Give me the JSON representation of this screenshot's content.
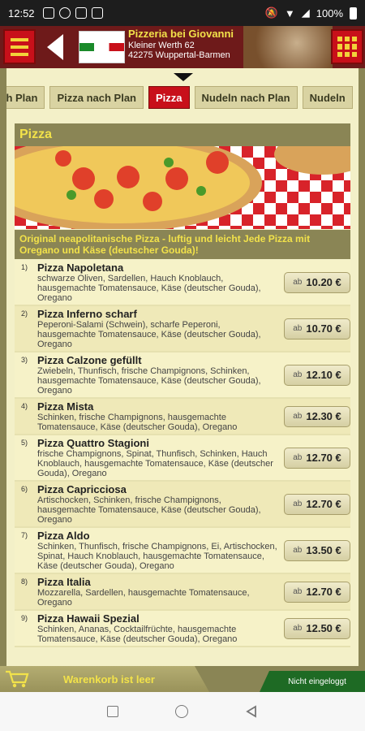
{
  "status_bar": {
    "time": "12:52",
    "battery": "100%"
  },
  "header": {
    "store_name": "Pizzeria bei Giovanni",
    "address_line1": "Kleiner Werth 62",
    "address_line2": "42275 Wuppertal-Barmen"
  },
  "tabs": [
    {
      "label": "ach Plan"
    },
    {
      "label": "Pizza nach Plan"
    },
    {
      "label": "Pizza"
    },
    {
      "label": "Nudeln nach Plan"
    },
    {
      "label": "Nudeln"
    }
  ],
  "section": {
    "title": "Pizza",
    "note": "Original neapolitanische Pizza - luftig und leicht Jede Pizza mit Oregano und Käse (deutscher Gouda)!"
  },
  "price_prefix": "ab",
  "items": [
    {
      "num": "1)",
      "name": "Pizza Napoletana",
      "desc": "schwarze Oliven, Sardellen, Hauch Knoblauch, hausgemachte Tomatensauce, Käse (deutscher Gouda), Oregano",
      "price": "10.20 €"
    },
    {
      "num": "2)",
      "name": "Pizza Inferno scharf",
      "desc": "Peperoni-Salami (Schwein), scharfe Peperoni, hausgemachte Tomatensauce, Käse (deutscher Gouda), Oregano",
      "price": "10.70 €"
    },
    {
      "num": "3)",
      "name": "Pizza Calzone gefüllt",
      "desc": "Zwiebeln, Thunfisch, frische Champignons, Schinken, hausgemachte Tomatensauce, Käse (deutscher Gouda), Oregano",
      "price": "12.10 €"
    },
    {
      "num": "4)",
      "name": "Pizza Mista",
      "desc": "Schinken, frische Champignons, hausgemachte Tomatensauce, Käse (deutscher Gouda), Oregano",
      "price": "12.30 €"
    },
    {
      "num": "5)",
      "name": "Pizza Quattro Stagioni",
      "desc": "frische Champignons, Spinat, Thunfisch, Schinken, Hauch Knoblauch, hausgemachte Tomatensauce, Käse (deutscher Gouda), Oregano",
      "price": "12.70 €"
    },
    {
      "num": "6)",
      "name": "Pizza Capricciosa",
      "desc": "Artischocken, Schinken, frische Champignons, hausgemachte Tomatensauce, Käse (deutscher Gouda), Oregano",
      "price": "12.70 €"
    },
    {
      "num": "7)",
      "name": "Pizza Aldo",
      "desc": "Schinken, Thunfisch, frische Champignons, Ei, Artischocken, Spinat, Hauch Knoblauch, hausgemachte Tomatensauce, Käse (deutscher Gouda), Oregano",
      "price": "13.50 €"
    },
    {
      "num": "8)",
      "name": "Pizza Italia",
      "desc": "Mozzarella, Sardellen, hausgemachte Tomatensauce, Oregano",
      "price": "12.70 €"
    },
    {
      "num": "9)",
      "name": "Pizza Hawaii Spezial",
      "desc": "Schinken, Ananas, Cocktailfrüchte, hausgemachte Tomatensauce, Käse (deutscher Gouda), Oregano",
      "price": "12.50 €"
    }
  ],
  "footer": {
    "cart_label": "Warenkorb ist leer",
    "login_label": "Nicht eingeloggt"
  },
  "colors": {
    "brand_red": "#c8101a",
    "accent_yellow": "#f2e24a",
    "olive": "#8a8555",
    "login_green": "#1e6a24"
  }
}
